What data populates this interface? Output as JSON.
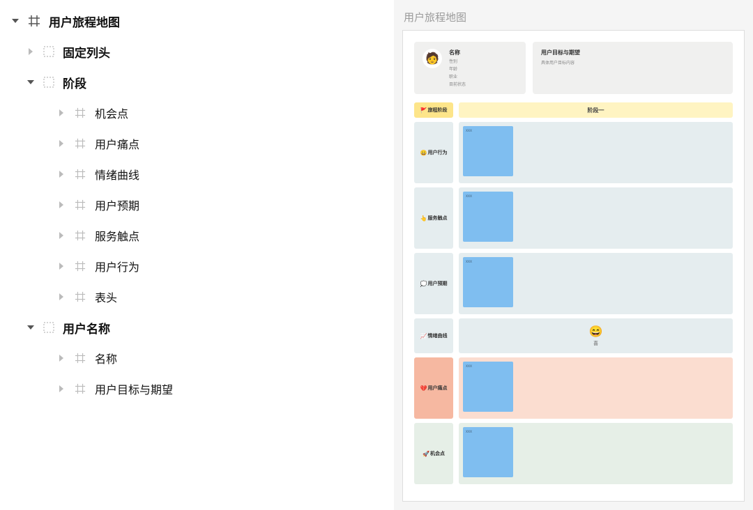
{
  "tree": {
    "root": {
      "label": "用户旅程地图"
    },
    "固定列头": "固定列头",
    "阶段": {
      "label": "阶段",
      "children": {
        "机会点": "机会点",
        "用户痛点": "用户痛点",
        "情绪曲线": "情绪曲线",
        "用户预期": "用户预期",
        "服务触点": "服务触点",
        "用户行为": "用户行为",
        "表头": "表头"
      }
    },
    "用户名称": {
      "label": "用户名称",
      "children": {
        "名称": "名称",
        "用户目标与期望": "用户目标与期望"
      }
    }
  },
  "preview": {
    "title": "用户旅程地图",
    "persona": {
      "emoji": "🧑",
      "title": "名称",
      "lines": [
        "性别",
        "年龄",
        "职业",
        "目前状态"
      ]
    },
    "goals": {
      "title": "用户目标与期望",
      "sub": "具体用户目标内容"
    },
    "grid": {
      "head_label": "旅程阶段",
      "stage_label": "阶段一",
      "rows": {
        "behavior": {
          "emoji": "😀",
          "label": "用户行为",
          "note": "xxx"
        },
        "touch": {
          "emoji": "👆",
          "label": "服务触点",
          "note": "xxx"
        },
        "expect": {
          "emoji": "💭",
          "label": "用户预期",
          "note": "xxx"
        },
        "curve": {
          "emoji": "📈",
          "label": "情绪曲线",
          "face": "😄",
          "facetext": "喜"
        },
        "pain": {
          "emoji": "💔",
          "label": "用户痛点",
          "note": "xxx"
        },
        "chance": {
          "emoji": "🚀",
          "label": "机会点",
          "note": "xxx"
        }
      }
    }
  }
}
